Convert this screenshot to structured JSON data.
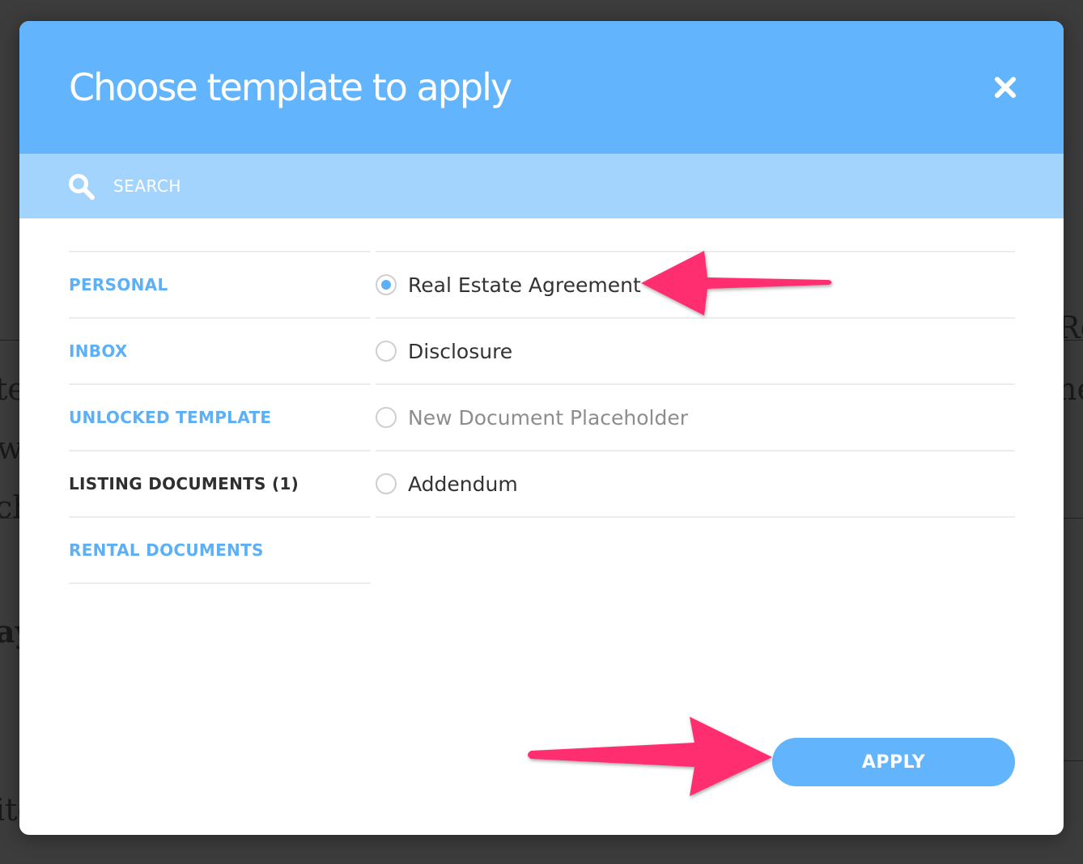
{
  "modal": {
    "title": "Choose template to apply",
    "close_icon": "close-icon"
  },
  "search": {
    "placeholder": "SEARCH",
    "icon": "search-icon"
  },
  "categories": [
    {
      "label": "PERSONAL",
      "active": false
    },
    {
      "label": "INBOX",
      "active": false
    },
    {
      "label": "UNLOCKED TEMPLATE",
      "active": false
    },
    {
      "label": "LISTING DOCUMENTS (1)",
      "active": true
    },
    {
      "label": "RENTAL DOCUMENTS",
      "active": false
    }
  ],
  "templates": [
    {
      "label": "Real Estate Agreement",
      "selected": true,
      "muted": false
    },
    {
      "label": "Disclosure",
      "selected": false,
      "muted": false
    },
    {
      "label": "New Document Placeholder",
      "selected": false,
      "muted": true
    },
    {
      "label": "Addendum",
      "selected": false,
      "muted": false
    }
  ],
  "footer": {
    "apply_label": "APPLY"
  },
  "colors": {
    "header": "#62b4fd",
    "search_bar": "#a3d4fd",
    "category_link": "#5db0f5",
    "active_category": "#2f2f2f",
    "annotation_arrow": "#ff2d6f",
    "backdrop": "#3c3c3c"
  }
}
